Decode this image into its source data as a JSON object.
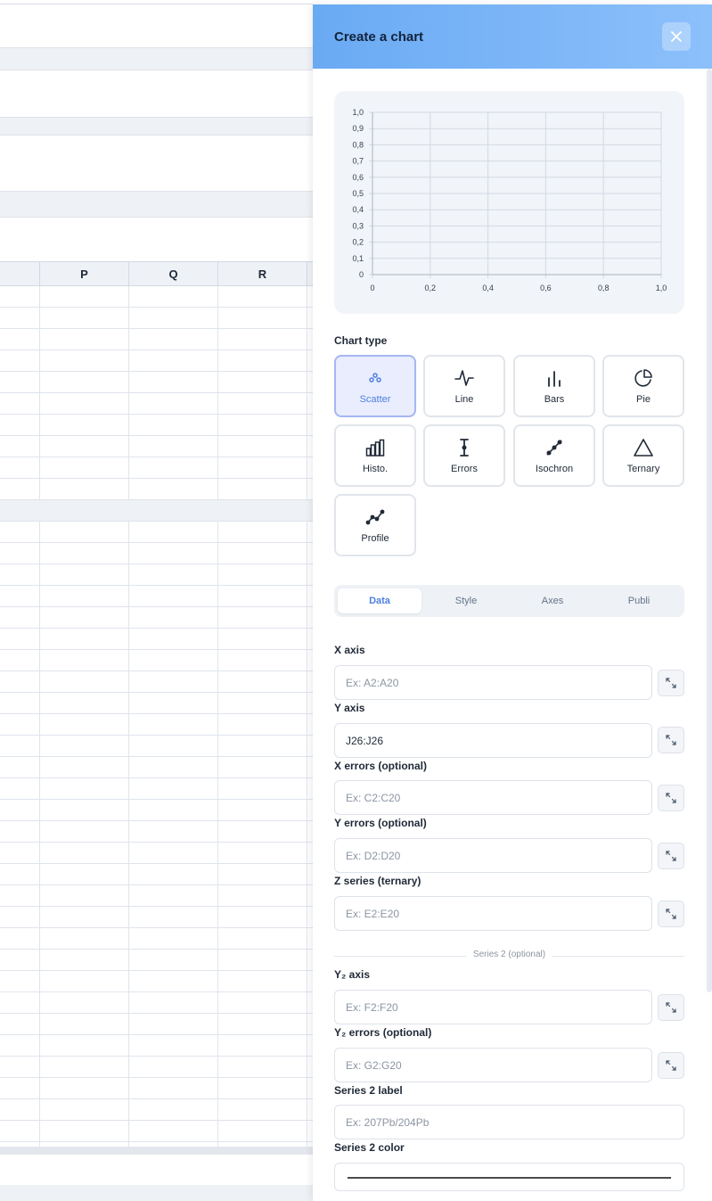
{
  "sheet": {
    "columns": [
      "P",
      "Q",
      "R"
    ]
  },
  "panel": {
    "title": "Create a chart",
    "close_icon": "close-icon"
  },
  "preview": {
    "chart_data": {
      "type": "scatter",
      "x_ticks": [
        "0",
        "0,2",
        "0,4",
        "0,6",
        "0,8",
        "1,0"
      ],
      "y_ticks": [
        "0",
        "0,1",
        "0,2",
        "0,3",
        "0,4",
        "0,5",
        "0,6",
        "0,7",
        "0,8",
        "0,9",
        "1,0"
      ],
      "xlim": [
        0,
        1
      ],
      "ylim": [
        0,
        1
      ],
      "series": [],
      "grid": true
    }
  },
  "chart_type": {
    "label": "Chart type",
    "selected": "Scatter",
    "options": [
      {
        "label": "Scatter",
        "icon": "scatter-icon"
      },
      {
        "label": "Line",
        "icon": "line-chart-icon"
      },
      {
        "label": "Bars",
        "icon": "bar-chart-icon"
      },
      {
        "label": "Pie",
        "icon": "pie-chart-icon"
      },
      {
        "label": "Histo.",
        "icon": "histogram-icon"
      },
      {
        "label": "Errors",
        "icon": "error-bar-icon"
      },
      {
        "label": "Isochron",
        "icon": "isochron-icon"
      },
      {
        "label": "Ternary",
        "icon": "triangle-icon"
      },
      {
        "label": "Profile",
        "icon": "profile-icon"
      }
    ]
  },
  "tabs": [
    {
      "label": "Data",
      "active": true
    },
    {
      "label": "Style",
      "active": false
    },
    {
      "label": "Axes",
      "active": false
    },
    {
      "label": "Publi",
      "active": false
    }
  ],
  "fields": {
    "x_axis": {
      "label": "X axis",
      "value": "",
      "placeholder": "Ex: A2:A20"
    },
    "y_axis": {
      "label": "Y axis",
      "value": "J26:J26",
      "placeholder": ""
    },
    "x_errors": {
      "label": "X errors (optional)",
      "value": "",
      "placeholder": "Ex: C2:C20"
    },
    "y_errors": {
      "label": "Y errors (optional)",
      "value": "",
      "placeholder": "Ex: D2:D20"
    },
    "z_series": {
      "label": "Z series (ternary)",
      "value": "",
      "placeholder": "Ex: E2:E20"
    },
    "series2_divider": "Series 2 (optional)",
    "y2_axis": {
      "label": "Y₂ axis",
      "value": "",
      "placeholder": "Ex: F2:F20"
    },
    "y2_errors": {
      "label": "Y₂ errors (optional)",
      "value": "",
      "placeholder": "Ex: G2:G20"
    },
    "series2_label": {
      "label": "Series 2 label",
      "value": "",
      "placeholder": "Ex: 207Pb/204Pb"
    },
    "series2_color": {
      "label": "Series 2 color",
      "value": "#4b4b4b"
    }
  }
}
